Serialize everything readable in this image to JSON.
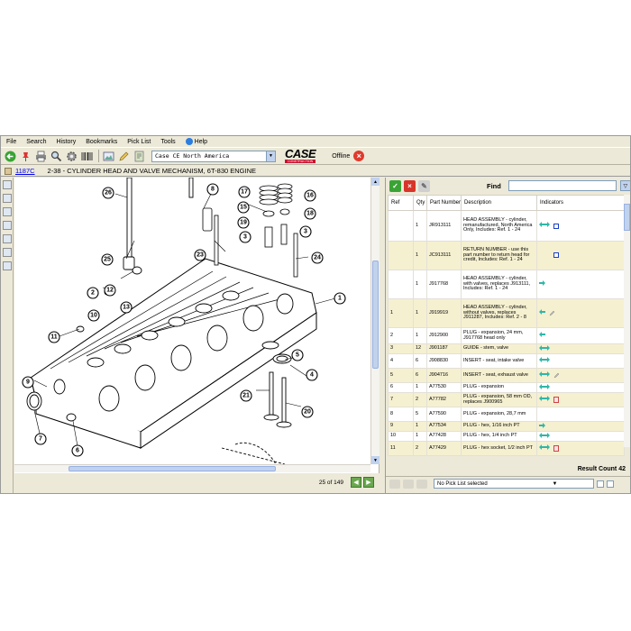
{
  "menu": {
    "items": [
      "File",
      "Search",
      "History",
      "Bookmarks",
      "Pick List",
      "Tools"
    ],
    "help": "Help"
  },
  "toolbar": {
    "catalog_select": "Case CE North America",
    "logo_text": "CASE",
    "logo_sub": "CONSTRUCTION",
    "status_label": "Offline",
    "status_icon": "offline-x-icon"
  },
  "titlebar": {
    "code": "1187C",
    "title": "2-38 - CYLINDER HEAD AND VALVE MECHANISM, 6T-830 ENGINE"
  },
  "drawing": {
    "callouts": [
      "26",
      "8",
      "17",
      "16",
      "18",
      "19",
      "15",
      "3",
      "3",
      "25",
      "12",
      "2",
      "13",
      "10",
      "24",
      "1",
      "11",
      "5",
      "4",
      "21",
      "20",
      "9",
      "7",
      "6",
      "23"
    ]
  },
  "pager": {
    "page_count": "25 of 149"
  },
  "parts": {
    "find_label": "Find",
    "find_value": "",
    "headers": {
      "ref": "Ref",
      "qty": "Qty",
      "part_number": "Part Number",
      "description": "Description",
      "indicators": "Indicators"
    },
    "rows": [
      {
        "ref": "",
        "qty": "1",
        "part": "JR913111",
        "desc": "HEAD ASSEMBLY - cylinder, remanufactured, North America Only, Includes: Ref. 1 - 24",
        "ind": [
          "arrow-both",
          "box"
        ]
      },
      {
        "ref": "",
        "qty": "1",
        "part": "JC913111",
        "desc": "RETURN NUMBER - use this part number to return head for credit, Includes: Ref. 1 - 24",
        "ind": [
          "",
          "box"
        ]
      },
      {
        "ref": "",
        "qty": "1",
        "part": "J917768",
        "desc": "HEAD ASSEMBLY - cylinder, with valves, replaces J913111, Includes: Ref. 1 - 24",
        "ind": [
          "arrow-right"
        ]
      },
      {
        "ref": "1",
        "qty": "1",
        "part": "J919919",
        "desc": "HEAD ASSEMBLY - cylinder, without valves, replaces J911287, Includes: Ref. 2 - 8",
        "ind": [
          "arrow-left",
          "note"
        ]
      },
      {
        "ref": "2",
        "qty": "1",
        "part": "J912900",
        "desc": "PLUG - expansion, 24 mm, J917768 head only",
        "ind": [
          "arrow-left"
        ]
      },
      {
        "ref": "3",
        "qty": "12",
        "part": "J901187",
        "desc": "GUIDE - stem, valve",
        "ind": [
          "arrow-both"
        ]
      },
      {
        "ref": "4",
        "qty": "6",
        "part": "J908830",
        "desc": "INSERT - seat, intake valve",
        "ind": [
          "arrow-both"
        ]
      },
      {
        "ref": "5",
        "qty": "6",
        "part": "J904716",
        "desc": "INSERT - seat, exhaust valve",
        "ind": [
          "arrow-both",
          "note"
        ]
      },
      {
        "ref": "6",
        "qty": "1",
        "part": "A77530",
        "desc": "PLUG - expansion",
        "ind": [
          "arrow-both"
        ]
      },
      {
        "ref": "7",
        "qty": "2",
        "part": "A77782",
        "desc": "PLUG - expansion, 58 mm OD, replaces J900965",
        "ind": [
          "arrow-both",
          "pdf"
        ]
      },
      {
        "ref": "8",
        "qty": "5",
        "part": "A77590",
        "desc": "PLUG - expansion, 28,7 mm",
        "ind": []
      },
      {
        "ref": "9",
        "qty": "1",
        "part": "A77534",
        "desc": "PLUG - hex, 1/16 inch PT",
        "ind": [
          "arrow-right"
        ]
      },
      {
        "ref": "10",
        "qty": "1",
        "part": "A77428",
        "desc": "PLUG - hex, 1/4 inch PT",
        "ind": [
          "arrow-both"
        ]
      },
      {
        "ref": "11",
        "qty": "2",
        "part": "A77429",
        "desc": "PLUG - hex socket, 1/2 inch PT",
        "ind": [
          "arrow-both",
          "pdf"
        ]
      }
    ],
    "result_count": "Result Count 42",
    "picklist_select": "No Pick List selected"
  },
  "colors": {
    "window_bg": "#ece9d8",
    "row_alt": "#f5f0d0",
    "link": "#0000ee",
    "arrow": "#2fb7a8",
    "offline": "#e03a2c"
  }
}
